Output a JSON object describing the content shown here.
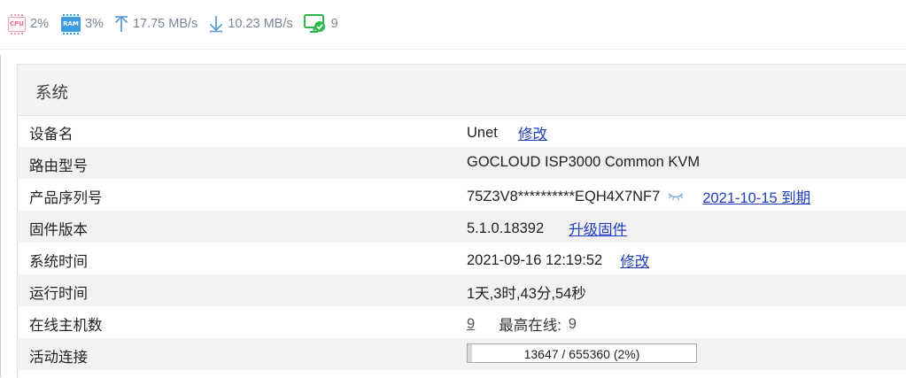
{
  "topbar": {
    "cpu": {
      "icon_label": "CPU",
      "value": "2%",
      "color": "#e36d95"
    },
    "ram": {
      "icon_label": "RAM",
      "value": "3%",
      "color": "#3d9ce0"
    },
    "upload": {
      "icon": "arrow-up-icon",
      "value": "17.75 MB/s"
    },
    "download": {
      "icon": "arrow-down-icon",
      "value": "10.23 MB/s"
    },
    "online": {
      "icon": "monitor-check-icon",
      "value": "9",
      "color": "#2db84d"
    }
  },
  "panel": {
    "title": "系统",
    "rows": [
      {
        "label": "设备名",
        "value": "Unet",
        "link": "修改"
      },
      {
        "label": "路由型号",
        "value": "GOCLOUD ISP3000 Common KVM"
      },
      {
        "label": "产品序列号",
        "value": "75Z3V8**********EQH4X7NF7",
        "link": "2021-10-15 到期"
      },
      {
        "label": "固件版本",
        "value": "5.1.0.18392",
        "link": "升级固件"
      },
      {
        "label": "系统时间",
        "value": "2021-09-16 12:19:52",
        "link": "修改"
      },
      {
        "label": "运行时间",
        "value": "1天,3时,43分,54秒"
      },
      {
        "label": "在线主机数",
        "value": "9",
        "extra_label": "最高在线:",
        "extra_value": "9"
      },
      {
        "label": "活动连接",
        "value": "13647 / 655360 (2%)",
        "progress": 0.02
      }
    ]
  },
  "colors": {
    "link": "#1f3fbf",
    "accent": "#3d9ce0"
  }
}
